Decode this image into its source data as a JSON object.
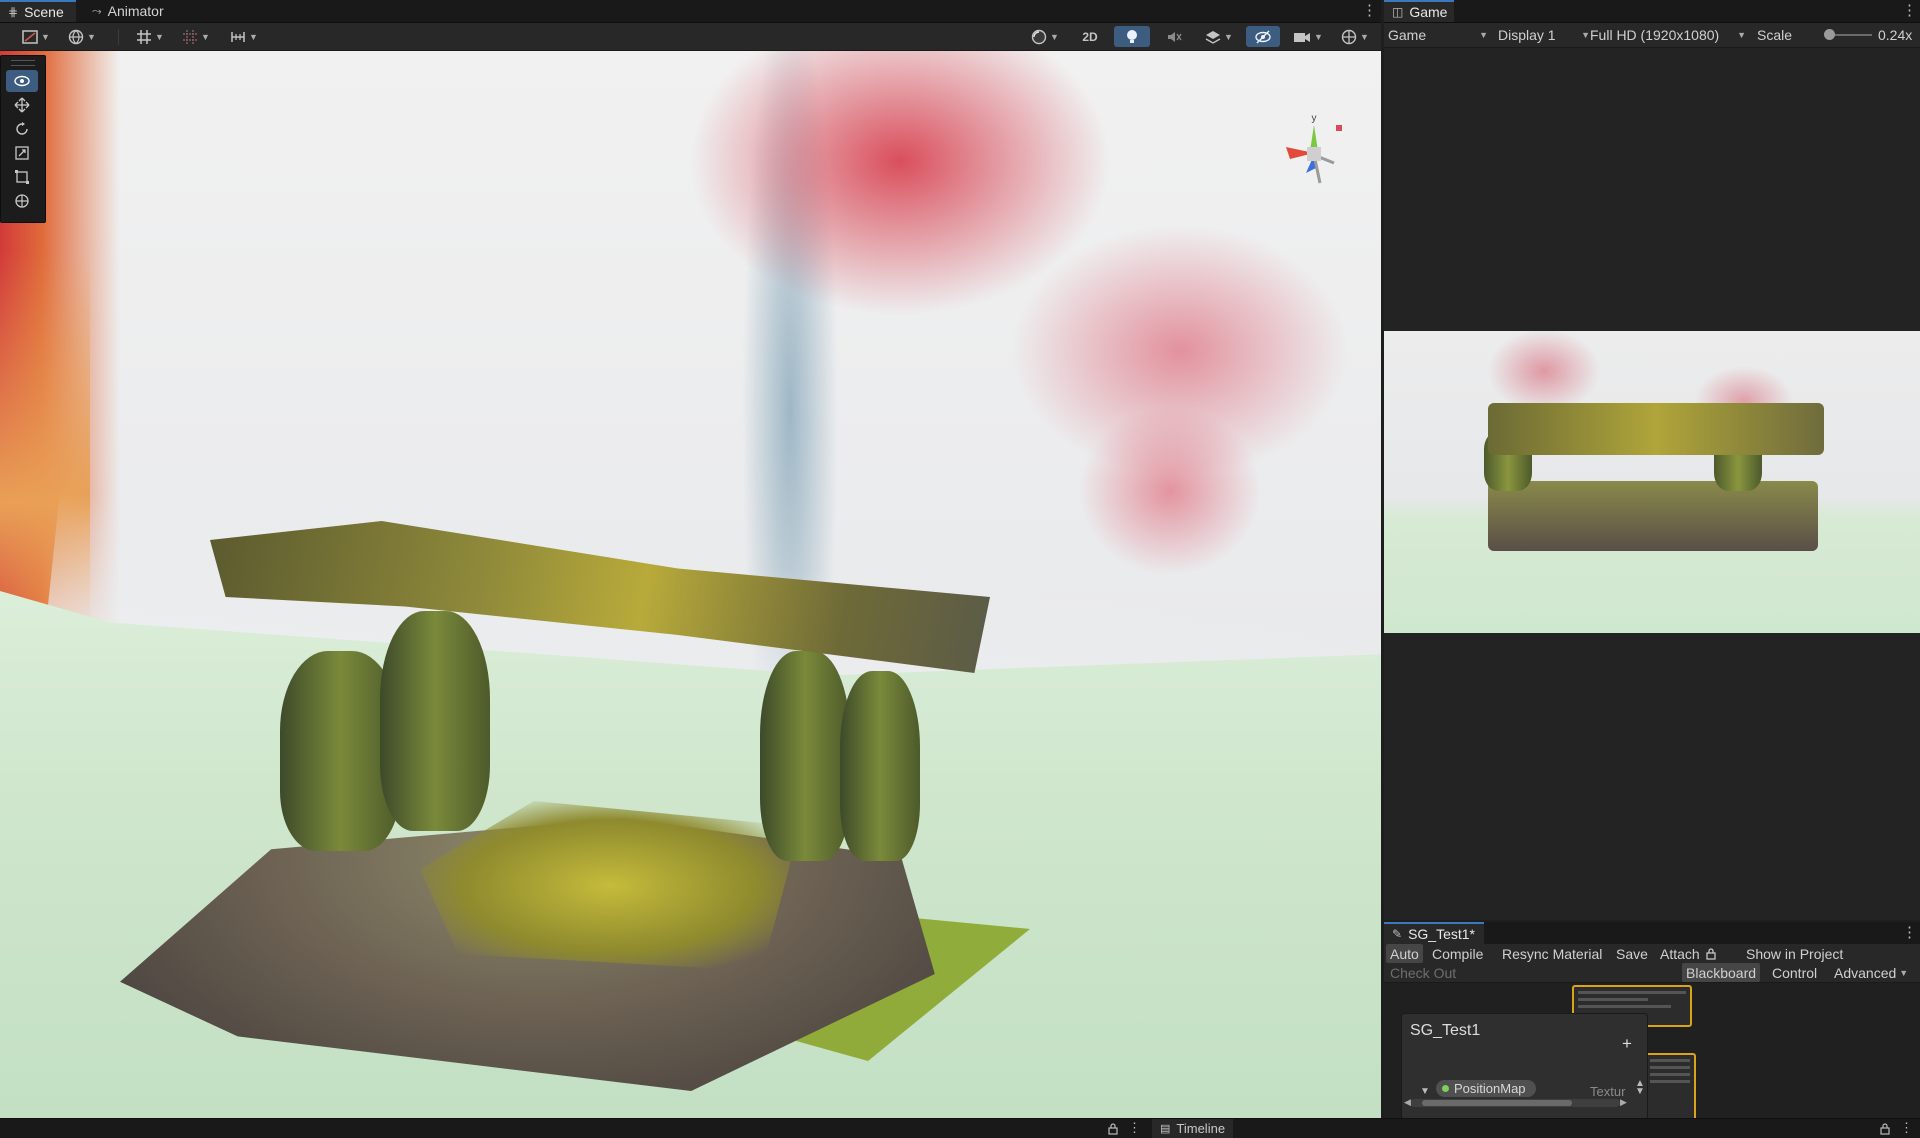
{
  "scene": {
    "tabs": [
      {
        "label": "Scene",
        "icon": "grid-icon"
      },
      {
        "label": "Animator",
        "icon": "animator-icon"
      }
    ],
    "toolbar": {
      "toggle_2d": "2D"
    },
    "tools": [
      "view-tool",
      "move-tool",
      "rotate-tool",
      "scale-tool",
      "rect-tool",
      "transform-tool"
    ],
    "gizmo_axis": "y"
  },
  "game": {
    "tab": {
      "label": "Game",
      "icon": "gamepad-icon"
    },
    "mode": "Game",
    "display": "Display 1",
    "resolution": "Full HD (1920x1080)",
    "scale_label": "Scale",
    "scale_value": "0.24x"
  },
  "shader_graph": {
    "tab": {
      "label": "SG_Test1*",
      "icon": "pen-icon"
    },
    "toolbar": {
      "auto": "Auto",
      "compile": "Compile",
      "resync": "Resync Material",
      "save": "Save",
      "attach": "Attach",
      "show_in_project": "Show in Project",
      "check_out": "Check Out",
      "blackboard": "Blackboard",
      "control": "Control",
      "advanced": "Advanced"
    },
    "blackboard": {
      "title": "SG_Test1",
      "add": "+",
      "property_name": "PositionMap",
      "property_type": "Textur"
    }
  },
  "status": {
    "timeline_tab": "Timeline"
  },
  "colors": {
    "accent": "#3d5d80",
    "node_border": "#d9a41c",
    "property_dot": "#7fd05a"
  }
}
